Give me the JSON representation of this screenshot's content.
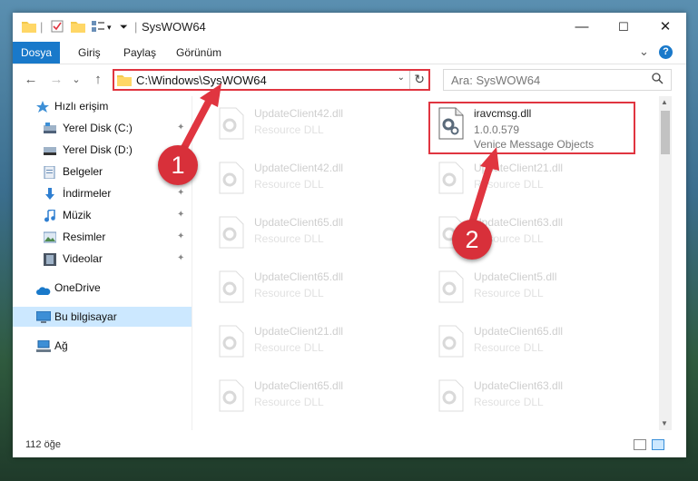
{
  "window": {
    "title": "SysWOW64",
    "controls": {
      "minimize": "—",
      "maximize": "☐",
      "close": "✕"
    }
  },
  "ribbon": {
    "tabs": [
      "Dosya",
      "Giriş",
      "Paylaş",
      "Görünüm"
    ],
    "active_tab": "Dosya",
    "collapse_glyph": "⌄",
    "help_glyph": "?"
  },
  "navigation": {
    "back": "←",
    "forward": "→",
    "recent": "⌄",
    "up": "↑"
  },
  "address_bar": {
    "path": "C:\\Windows\\SysWOW64",
    "dropdown_glyph": "⌄",
    "refresh_glyph": "↻"
  },
  "search": {
    "placeholder": "Ara: SysWOW64",
    "icon_glyph": "⚲"
  },
  "sidebar": {
    "items": [
      {
        "label": "Hızlı erişim",
        "icon": "star-icon",
        "pinned": false
      },
      {
        "label": "Yerel Disk (C:)",
        "icon": "drive-icon",
        "pinned": true
      },
      {
        "label": "Yerel Disk (D:)",
        "icon": "drive-icon",
        "pinned": true
      },
      {
        "label": "Belgeler",
        "icon": "documents-icon",
        "pinned": true
      },
      {
        "label": "İndirmeler",
        "icon": "download-icon",
        "pinned": true
      },
      {
        "label": "Müzik",
        "icon": "music-icon",
        "pinned": true
      },
      {
        "label": "Resimler",
        "icon": "pictures-icon",
        "pinned": true
      },
      {
        "label": "Videolar",
        "icon": "videos-icon",
        "pinned": true
      },
      {
        "label": "OneDrive",
        "icon": "cloud-icon",
        "pinned": false
      },
      {
        "label": "Bu bilgisayar",
        "icon": "computer-icon",
        "pinned": false,
        "selected": true
      },
      {
        "label": "Ağ",
        "icon": "network-icon",
        "pinned": false
      }
    ],
    "pin_glyph": "📌"
  },
  "files": {
    "left_column": [
      {
        "name": "UpdateClient42.dll",
        "desc": "Resource DLL"
      },
      {
        "name": "UpdateClient42.dll",
        "desc": "Resource DLL"
      },
      {
        "name": "UpdateClient65.dll",
        "desc": "Resource DLL"
      },
      {
        "name": "UpdateClient65.dll",
        "desc": "Resource DLL"
      },
      {
        "name": "UpdateClient21.dll",
        "desc": "Resource DLL"
      },
      {
        "name": "UpdateClient65.dll",
        "desc": "Resource DLL"
      }
    ],
    "right_column": [
      {
        "name": "iravcmsg.dll",
        "version": "1.0.0.579",
        "desc": "Venice Message Objects",
        "highlighted": true
      },
      {
        "name": "UpdateClient21.dll",
        "desc": "Resource DLL"
      },
      {
        "name": "UpdateClient63.dll",
        "desc": "Resource DLL"
      },
      {
        "name": "UpdateClient5.dll",
        "desc": "Resource DLL"
      },
      {
        "name": "UpdateClient65.dll",
        "desc": "Resource DLL"
      },
      {
        "name": "UpdateClient63.dll",
        "desc": "Resource DLL"
      }
    ]
  },
  "status_bar": {
    "item_count": "112 öğe"
  },
  "annotations": {
    "step1": "1",
    "step2": "2",
    "color": "#e03540"
  },
  "colors": {
    "accent": "#1979ca",
    "selection": "#cce8ff",
    "annotation_red": "#e03540"
  }
}
